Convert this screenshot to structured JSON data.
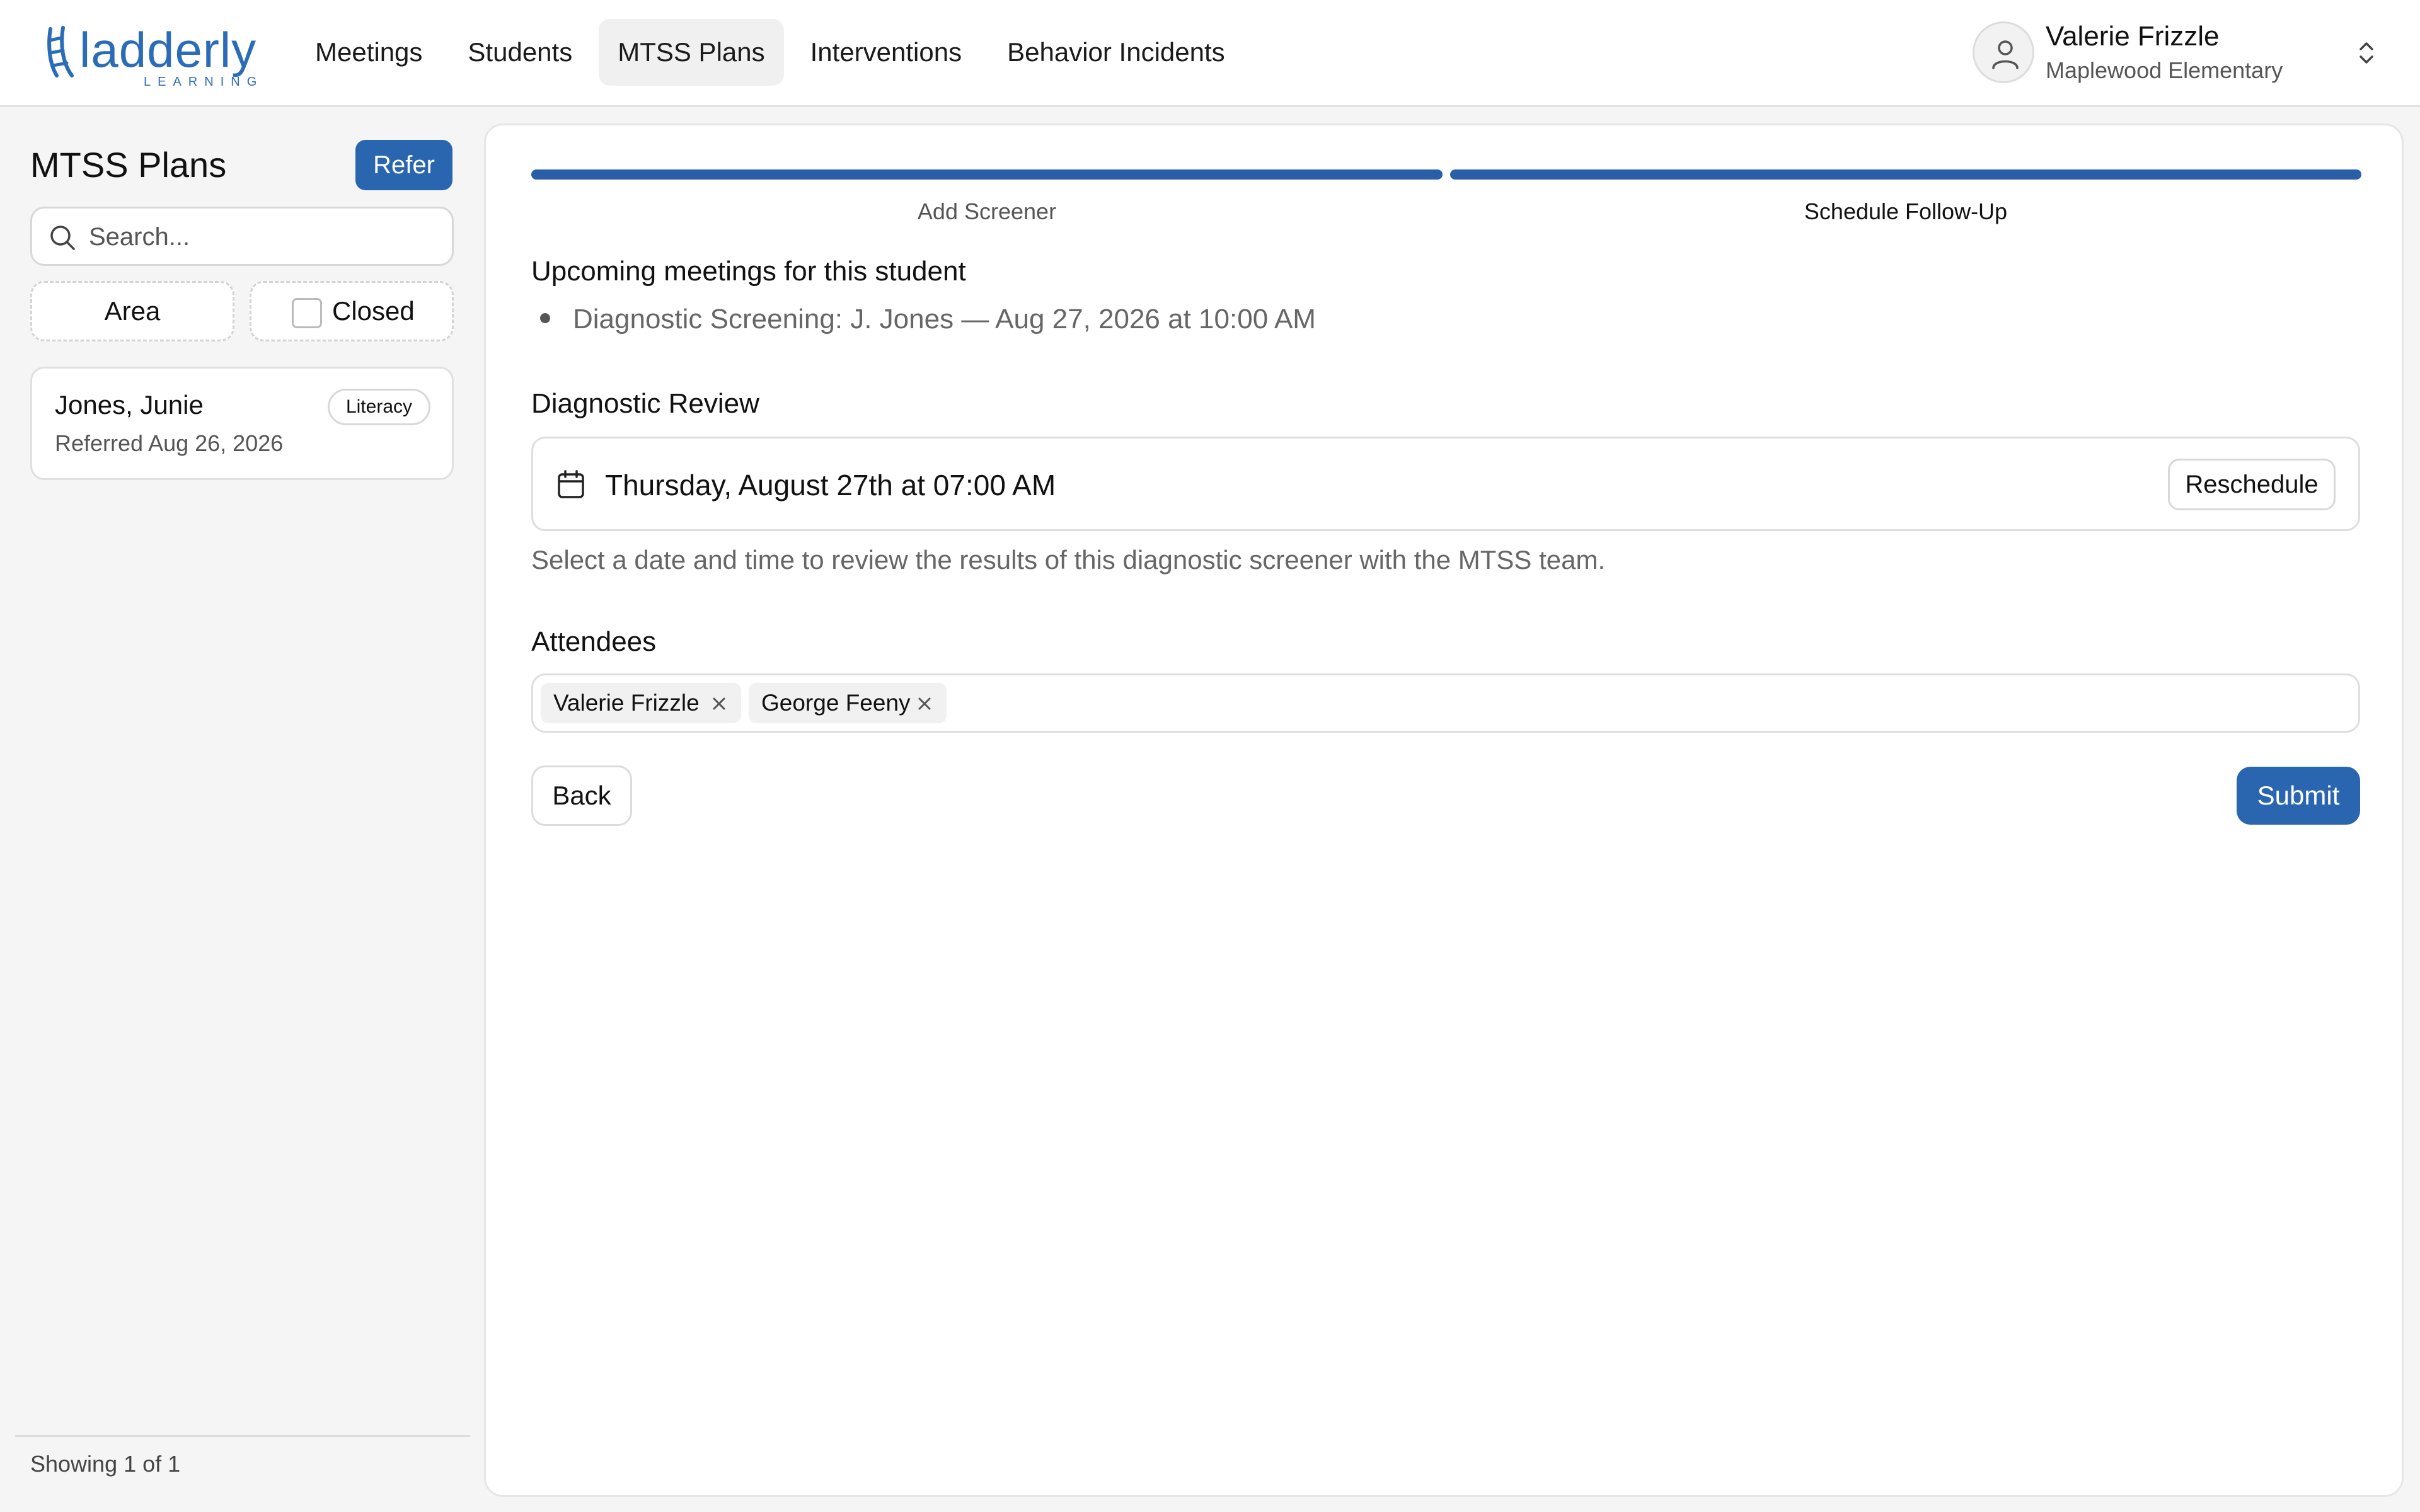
{
  "brand": {
    "name": "ladderly",
    "tagline": "LEARNING",
    "color": "#2b6cb8"
  },
  "nav": {
    "items": [
      {
        "label": "Meetings"
      },
      {
        "label": "Students"
      },
      {
        "label": "MTSS Plans",
        "active": true
      },
      {
        "label": "Interventions"
      },
      {
        "label": "Behavior Incidents"
      }
    ]
  },
  "user": {
    "name": "Valerie Frizzle",
    "school": "Maplewood Elementary"
  },
  "sidebar": {
    "title": "MTSS Plans",
    "refer_label": "Refer",
    "search_placeholder": "Search...",
    "search_value": "",
    "filters": {
      "area_label": "Area",
      "closed_label": "Closed",
      "closed_checked": false
    },
    "students": [
      {
        "name": "Jones, Junie",
        "referred": "Referred Aug 26, 2026",
        "area": "Literacy"
      }
    ],
    "footer": "Showing 1 of 1"
  },
  "main": {
    "steps": [
      {
        "label": "Add Screener",
        "complete": true
      },
      {
        "label": "Schedule Follow-Up",
        "current": true
      }
    ],
    "upcoming_title": "Upcoming meetings for this student",
    "upcoming": [
      "Diagnostic Screening: J. Jones — Aug 27, 2026 at 10:00 AM"
    ],
    "review_title": "Diagnostic Review",
    "review_datetime": "Thursday, August 27th at 07:00 AM",
    "reschedule_label": "Reschedule",
    "review_helper": "Select a date and time to review the results of this diagnostic screener with the MTSS team.",
    "attendees_title": "Attendees",
    "attendees": [
      "Valerie Frizzle",
      "George Feeny"
    ],
    "back_label": "Back",
    "submit_label": "Submit"
  },
  "colors": {
    "primary": "#2a66b0",
    "step_bar": "#2a5fa8"
  }
}
